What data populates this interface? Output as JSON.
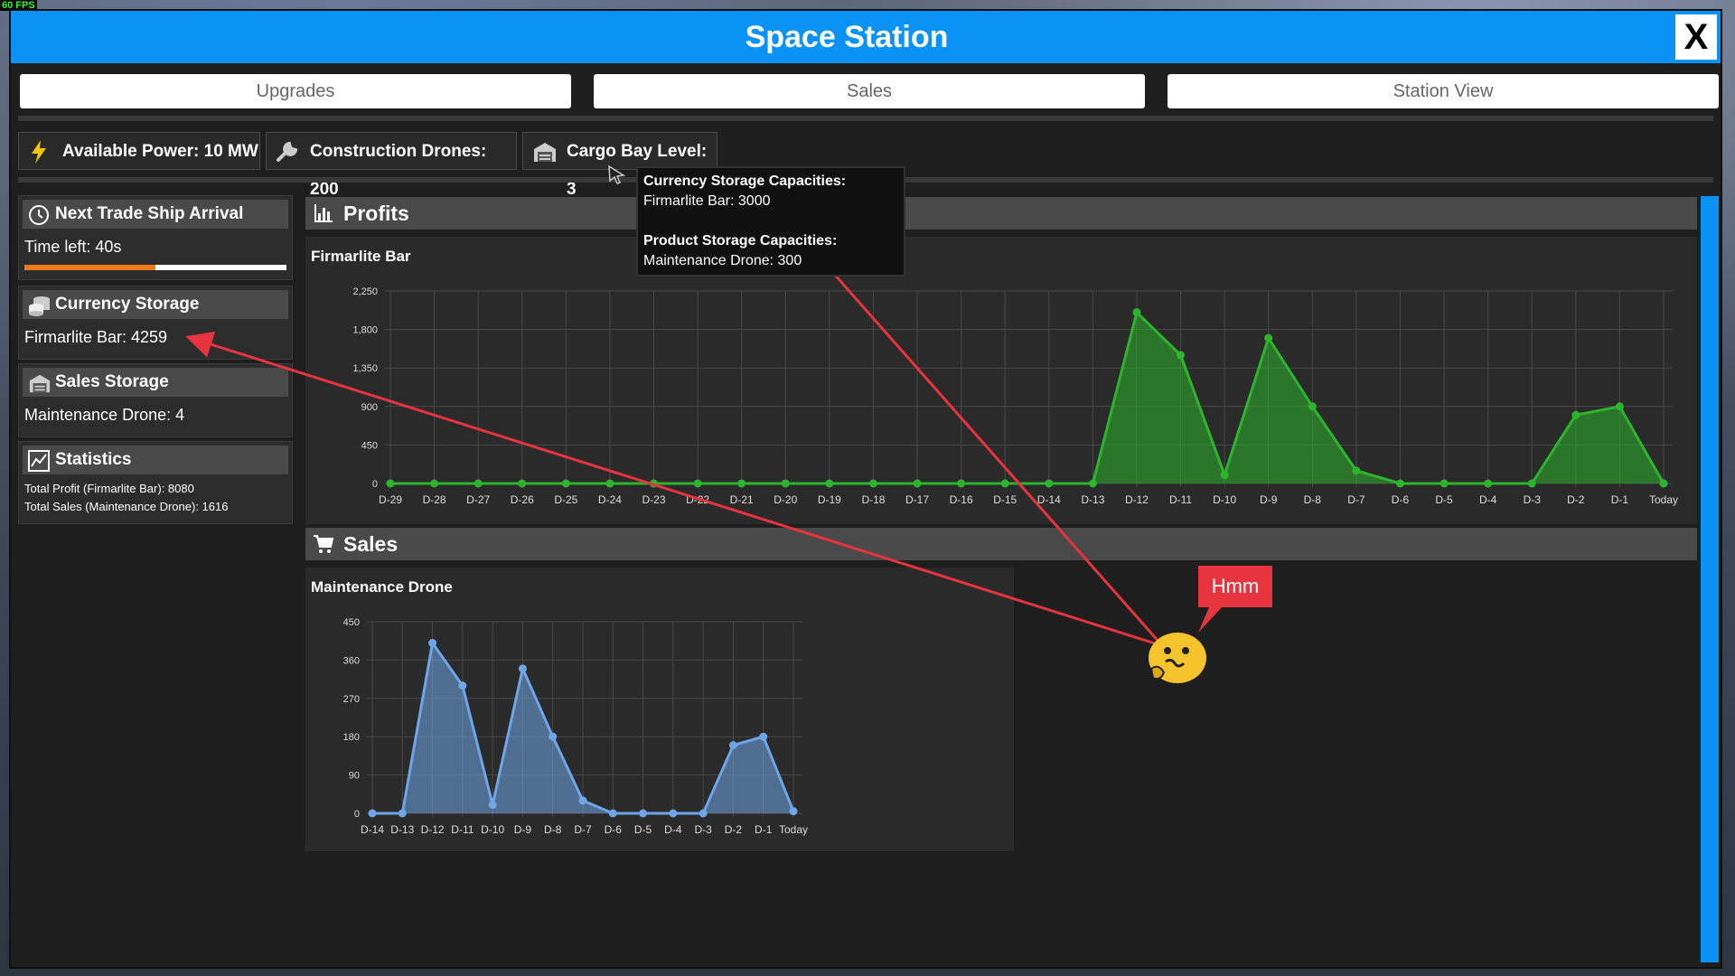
{
  "window": {
    "title": "Space Station",
    "close_label": "X"
  },
  "overlay": {
    "fps": "60 FPS"
  },
  "tabs": [
    "Upgrades",
    "Sales",
    "Station View"
  ],
  "stats": {
    "power": "Available Power: 10 MW",
    "drones": "Construction Drones: 200",
    "cargo": "Cargo Bay Level: 3"
  },
  "tooltip": {
    "currency_header": "Currency Storage Capacities:",
    "currency_value": "Firmarlite Bar: 3000",
    "product_header": "Product Storage Capacities:",
    "product_value": "Maintenance Drone: 300"
  },
  "sidebar": {
    "trade": {
      "title": "Next Trade Ship Arrival",
      "time_left": "Time left: 40s",
      "progress": 0.5
    },
    "currency": {
      "title": "Currency Storage",
      "value": "Firmarlite Bar: 4259"
    },
    "sales_storage": {
      "title": "Sales Storage",
      "value": "Maintenance Drone: 4"
    },
    "statistics": {
      "title": "Statistics",
      "profit": "Total Profit (Firmarlite Bar): 8080",
      "sales": "Total Sales (Maintenance Drone): 1616"
    }
  },
  "sections": {
    "profits": "Profits",
    "sales": "Sales"
  },
  "annotation": {
    "bubble": "Hmm"
  },
  "colors": {
    "accent": "#0a93f5",
    "profit_line": "#2db52d",
    "sales_line": "#6ea6e8",
    "arrow": "#e8343e",
    "progress": "#f07a18"
  },
  "chart_data": [
    {
      "type": "area",
      "title": "Firmarlite Bar",
      "categories": [
        "D-29",
        "D-28",
        "D-27",
        "D-26",
        "D-25",
        "D-24",
        "D-23",
        "D-22",
        "D-21",
        "D-20",
        "D-19",
        "D-18",
        "D-17",
        "D-16",
        "D-15",
        "D-14",
        "D-13",
        "D-12",
        "D-11",
        "D-10",
        "D-9",
        "D-8",
        "D-7",
        "D-6",
        "D-5",
        "D-4",
        "D-3",
        "D-2",
        "D-1",
        "Today"
      ],
      "values": [
        0,
        0,
        0,
        0,
        0,
        0,
        0,
        0,
        0,
        0,
        0,
        0,
        0,
        0,
        0,
        0,
        0,
        2000,
        1500,
        100,
        1700,
        900,
        150,
        0,
        0,
        0,
        0,
        800,
        900,
        0
      ],
      "yticks": [
        0,
        450,
        900,
        1350,
        1800,
        2250
      ],
      "ytick_labels": [
        "0",
        "450",
        "900",
        "1,350",
        "1,800",
        "2,250"
      ],
      "ylim": [
        0,
        2250
      ],
      "grid": true
    },
    {
      "type": "area",
      "title": "Maintenance Drone",
      "categories": [
        "D-14",
        "D-13",
        "D-12",
        "D-11",
        "D-10",
        "D-9",
        "D-8",
        "D-7",
        "D-6",
        "D-5",
        "D-4",
        "D-3",
        "D-2",
        "D-1",
        "Today"
      ],
      "values": [
        0,
        0,
        400,
        300,
        20,
        340,
        180,
        30,
        0,
        0,
        0,
        0,
        160,
        180,
        5
      ],
      "yticks": [
        0,
        90,
        180,
        270,
        360,
        450
      ],
      "ytick_labels": [
        "0",
        "90",
        "180",
        "270",
        "360",
        "450"
      ],
      "ylim": [
        0,
        450
      ],
      "grid": true
    }
  ]
}
